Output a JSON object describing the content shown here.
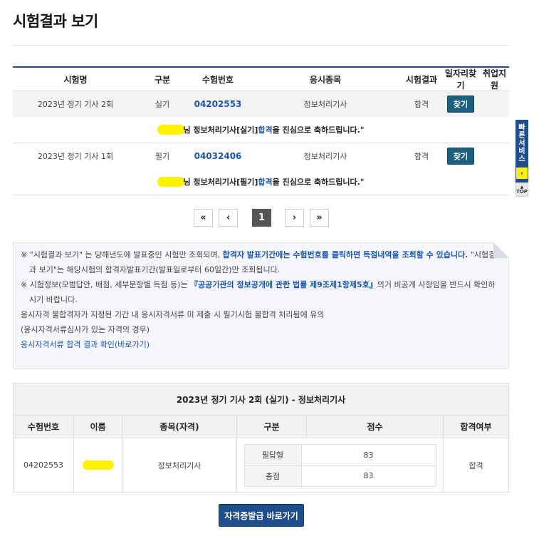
{
  "page": {
    "title": "시험결과 보기"
  },
  "results": {
    "headers": [
      "시험명",
      "구분",
      "수험번호",
      "응시종목",
      "시험결과",
      "일자리찾기",
      "취업지원"
    ],
    "rows": [
      {
        "exam": "2023년 정기 기사 2회",
        "type": "실기",
        "number": "04202553",
        "subject": "정보처리기사",
        "result": "합격",
        "job_button": "찾기",
        "msg_pre": "님 정보처리기사[실기] ",
        "msg_pass": "합격",
        "msg_post": "을 진심으로 축하드립니다.\""
      },
      {
        "exam": "2023년 정기 기사 1회",
        "type": "필기",
        "number": "04032406",
        "subject": "정보처리기사",
        "result": "합격",
        "job_button": "찾기",
        "msg_pre": "님 정보처리기사[필기] ",
        "msg_pass": "합격",
        "msg_post": "을 진심으로 축하드립니다.\""
      }
    ]
  },
  "pagination": {
    "first": "«",
    "prev": "‹",
    "current": "1",
    "next": "›",
    "last": "»"
  },
  "notice": {
    "item1_a": "\"시험결과 보기\" 는 당해년도에 발표중인 시험만 조회되며, ",
    "item1_b": "합격자 발표기간에는 수험번호를 클릭하면 득점내역을 조회할 수 있습니다.",
    "item1_c": " \"시험결과 보기\"는 해당시험의 합격자발표기간(발표일로부터 60일간)만 조회됩니다.",
    "item2_a": "시험정보(모범답안, 배점, 세부문항별 득점 등)는 ",
    "item2_b": "『공공기관의 정보공개에 관한 법률 제9조제1항제5호』",
    "item2_c": "의거 비공개 사항임을 반드시 확인하시기 바랍니다.",
    "line3": "응시자격 불합격자가 지정된 기간 내 응시자격서류 미 제출 시 필기시험 불합격 처리됨에 유의",
    "line4": "(응시자격서류심사가 있는 자격의 경우)",
    "link": "응시자격서류 합격 결과 확인(바로가기)",
    "marker": "※"
  },
  "detail": {
    "title": "2023년 정기 기사 2회 (실기) - 정보처리기사",
    "headers": [
      "수험번호",
      "이름",
      "종목(자격)",
      "구분",
      "점수",
      "합격여부"
    ],
    "number": "04202553",
    "subject": "정보처리기사",
    "scores": [
      {
        "label": "필답형",
        "value": "83"
      },
      {
        "label": "총점",
        "value": "83"
      }
    ],
    "pass": "합격"
  },
  "cta": {
    "label": "자격증발급 바로가기"
  },
  "quick": {
    "label_1": "빠",
    "label_2": "른",
    "label_3": "서",
    "label_4": "비",
    "label_5": "스",
    "arrow": "‹",
    "top": "TOP"
  },
  "colors": {
    "accent": "#1f4e8c",
    "link": "#1a56b0",
    "highlight": "#fff200"
  }
}
